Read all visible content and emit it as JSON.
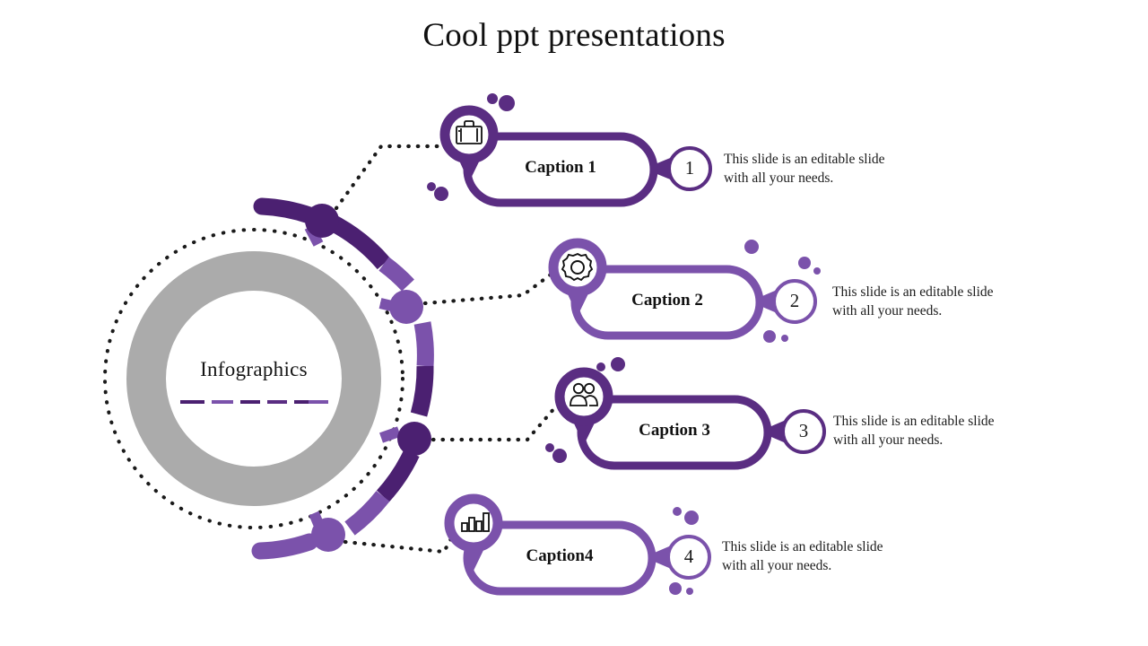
{
  "slide": {
    "title": "Cool ppt presentations",
    "background": "#FFFFFF"
  },
  "hub": {
    "label": "Infographics",
    "ring_color": "#ABABAB",
    "dotted_circle_color": "#1A1A1A",
    "underline_dash_colors": [
      "#4B2071",
      "#7B52AB"
    ]
  },
  "colors": {
    "dark_purple": "#5A2D82",
    "mid_purple": "#6B3A95",
    "light_purple": "#7B52AB",
    "deep_purple": "#4B2071",
    "text": "#1C1C1C",
    "grey": "#ABABAB"
  },
  "rows": [
    {
      "id": "row-1",
      "caption": "Caption 1",
      "number": "1",
      "icon": "briefcase-icon",
      "color": "#5A2D82",
      "description": "This slide is an editable slide\nwith all your needs."
    },
    {
      "id": "row-2",
      "caption": "Caption 2",
      "number": "2",
      "icon": "gear-icon",
      "color": "#7B52AB",
      "description": "This slide is an editable slide\nwith all your needs."
    },
    {
      "id": "row-3",
      "caption": "Caption 3",
      "number": "3",
      "icon": "users-icon",
      "color": "#5A2D82",
      "description": "This slide is an editable slide\nwith all your needs."
    },
    {
      "id": "row-4",
      "caption": "Caption4",
      "number": "4",
      "icon": "bar-chart-icon",
      "color": "#7B52AB",
      "description": "This slide is an editable slide\nwith all your needs."
    }
  ]
}
